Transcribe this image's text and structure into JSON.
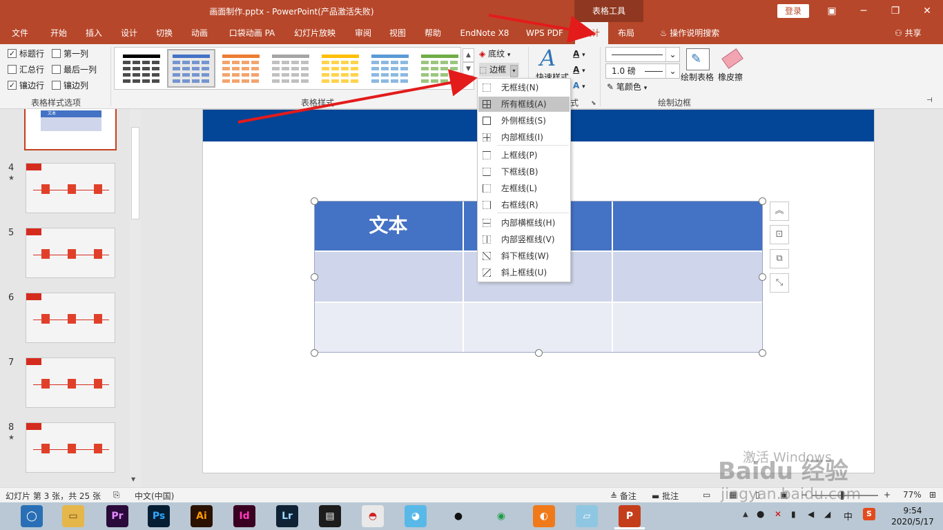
{
  "titlebar": {
    "title": "画面制作.pptx  -  PowerPoint(产品激活失败)",
    "context_tab": "表格工具",
    "login": "登录"
  },
  "tabs": [
    "文件",
    "开始",
    "插入",
    "设计",
    "切换",
    "动画",
    "口袋动画 PA",
    "幻灯片放映",
    "审阅",
    "视图",
    "帮助",
    "EndNote X8",
    "WPS PDF",
    "设计",
    "布局"
  ],
  "tell_me": "操作说明搜索",
  "share": "共享",
  "ribbon": {
    "table_style_options": {
      "label": "表格样式选项",
      "checks": [
        {
          "label": "标题行",
          "checked": true
        },
        {
          "label": "第一列",
          "checked": false
        },
        {
          "label": "汇总行",
          "checked": false
        },
        {
          "label": "最后一列",
          "checked": false
        },
        {
          "label": "镶边行",
          "checked": true
        },
        {
          "label": "镶边列",
          "checked": false
        }
      ]
    },
    "table_styles": {
      "label": "表格样式",
      "gallery_colors": [
        "#000000",
        "#4472c4",
        "#ed7d31",
        "#a5a5a5",
        "#ffc000",
        "#5b9bd5",
        "#70ad47"
      ],
      "shading": "底纹",
      "borders": "边框"
    },
    "wordart": {
      "quick_styles": "快速样式",
      "label_partial": "式"
    },
    "draw_borders": {
      "label": "绘制边框",
      "weight": "1.0 磅",
      "pen_color": "笔颜色",
      "draw_table": "绘制表格",
      "eraser": "橡皮擦"
    }
  },
  "border_menu": [
    {
      "label": "无框线(N)",
      "icon": "no-border-icon"
    },
    {
      "label": "所有框线(A)",
      "icon": "all-borders-icon",
      "highlighted": true
    },
    {
      "label": "外侧框线(S)",
      "icon": "outside-borders-icon"
    },
    {
      "label": "内部框线(I)",
      "icon": "inside-borders-icon"
    },
    {
      "label": "上框线(P)",
      "icon": "top-border-icon"
    },
    {
      "label": "下框线(B)",
      "icon": "bottom-border-icon"
    },
    {
      "label": "左框线(L)",
      "icon": "left-border-icon"
    },
    {
      "label": "右框线(R)",
      "icon": "right-border-icon"
    },
    {
      "label": "内部横框线(H)",
      "icon": "inside-horizontal-border-icon"
    },
    {
      "label": "内部竖框线(V)",
      "icon": "inside-vertical-border-icon"
    },
    {
      "label": "斜下框线(W)",
      "icon": "diagonal-down-border-icon"
    },
    {
      "label": "斜上框线(U)",
      "icon": "diagonal-up-border-icon"
    }
  ],
  "slides_pane": {
    "slides": [
      {
        "num": "4",
        "star": true
      },
      {
        "num": "5",
        "star": false
      },
      {
        "num": "6",
        "star": false
      },
      {
        "num": "7",
        "star": false
      },
      {
        "num": "8",
        "star": true
      }
    ],
    "top_thumb_text": "文本"
  },
  "table": {
    "header_text": "文本",
    "rows": 3,
    "cols": 3
  },
  "status": {
    "slide_info": "幻灯片 第 3 张，共 25 张",
    "language": "中文(中国)",
    "notes": "备注",
    "comments": "批注",
    "zoom": "77%"
  },
  "taskbar": {
    "apps": [
      {
        "name": "browser-icon",
        "label": "◯",
        "bg": "#2a6fb5",
        "fg": "#ffffff"
      },
      {
        "name": "file-explorer-icon",
        "label": "▭",
        "bg": "#e5b64a",
        "fg": "#6b4b12"
      },
      {
        "name": "premiere-icon",
        "label": "Pr",
        "bg": "#2a0a3a",
        "fg": "#e58bff"
      },
      {
        "name": "photoshop-icon",
        "label": "Ps",
        "bg": "#061e33",
        "fg": "#31a8ff"
      },
      {
        "name": "illustrator-icon",
        "label": "Ai",
        "bg": "#2b1100",
        "fg": "#ff9a00"
      },
      {
        "name": "indesign-icon",
        "label": "Id",
        "bg": "#3a0022",
        "fg": "#ff3dbd"
      },
      {
        "name": "lightroom-icon",
        "label": "Lr",
        "bg": "#0f2235",
        "fg": "#9fd7ff"
      },
      {
        "name": "video-editor-icon",
        "label": "▤",
        "bg": "#1c1c1c",
        "fg": "#ffffff"
      },
      {
        "name": "umbrella-app-icon",
        "label": "◓",
        "bg": "#e9e9e9",
        "fg": "#d02020"
      },
      {
        "name": "cat-app-icon",
        "label": "◕",
        "bg": "#58b9e8",
        "fg": "#ffffff"
      },
      {
        "name": "qq-icon",
        "label": "●",
        "bg": "#b9c8d4",
        "fg": "#111111"
      },
      {
        "name": "chrome-icon",
        "label": "◉",
        "bg": "#b9c8d4",
        "fg": "#1e9c47"
      },
      {
        "name": "foxmail-icon",
        "label": "◐",
        "bg": "#f07a1a",
        "fg": "#ffffff"
      },
      {
        "name": "notes-app-icon",
        "label": "▱",
        "bg": "#8fc7e3",
        "fg": "#ffffff"
      },
      {
        "name": "powerpoint-taskbar-icon",
        "label": "P",
        "bg": "#c43e1c",
        "fg": "#ffffff"
      }
    ],
    "ime": "中",
    "time": "9:54",
    "date": "2020/5/17"
  },
  "watermark": {
    "activate": "激活 Windows",
    "site": "jingyan.baidu.com",
    "brand": "Baidu 经验"
  },
  "colors": {
    "accent": "#b7472a",
    "banner": "#034596",
    "table_header": "#4472c4",
    "table_band1": "#cfd5ea",
    "table_band2": "#e9ebf5",
    "arrow": "#e31b1b"
  }
}
